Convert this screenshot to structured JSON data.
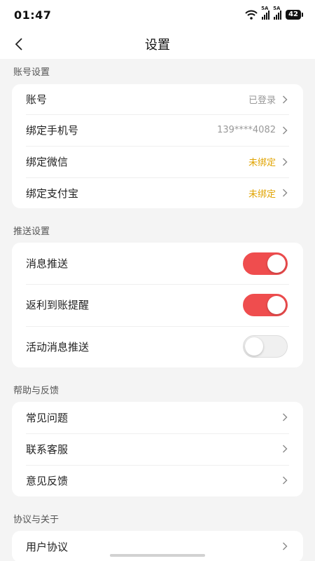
{
  "status_bar": {
    "time": "01:47",
    "signal1": "5A",
    "signal2": "5A",
    "battery": "42"
  },
  "nav": {
    "title": "设置"
  },
  "account": {
    "title": "账号设置",
    "items": [
      {
        "label": "账号",
        "value": "已登录"
      },
      {
        "label": "绑定手机号",
        "value": "139****4082"
      },
      {
        "label": "绑定微信",
        "value": "未绑定"
      },
      {
        "label": "绑定支付宝",
        "value": "未绑定"
      }
    ]
  },
  "push": {
    "title": "推送设置",
    "items": [
      {
        "label": "消息推送",
        "enabled": true
      },
      {
        "label": "返利到账提醒",
        "enabled": true
      },
      {
        "label": "活动消息推送",
        "enabled": false
      }
    ]
  },
  "help": {
    "title": "帮助与反馈",
    "items": [
      {
        "label": "常见问题"
      },
      {
        "label": "联系客服"
      },
      {
        "label": "意见反馈"
      }
    ]
  },
  "about": {
    "title": "协议与关于",
    "items": [
      {
        "label": "用户协议"
      }
    ]
  },
  "colors": {
    "accent": "#ef4d4e",
    "warning": "#e0a300",
    "muted": "#999999",
    "background": "#f4f4f4"
  }
}
